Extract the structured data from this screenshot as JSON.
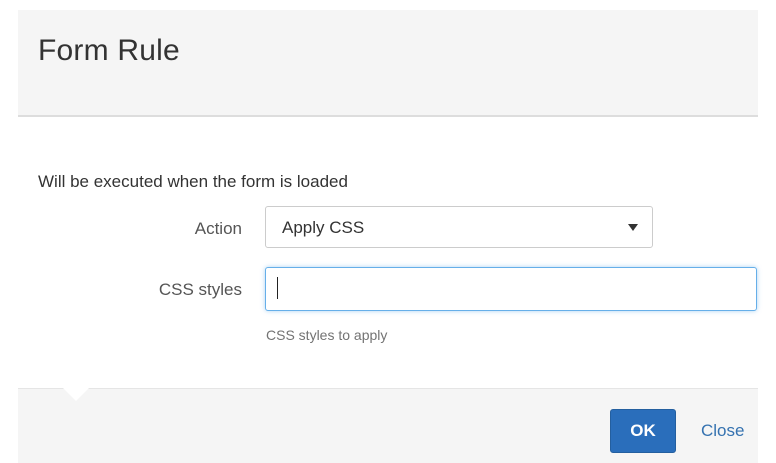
{
  "dialog": {
    "title": "Form Rule"
  },
  "body": {
    "description": "Will be executed when the form is loaded",
    "action": {
      "label": "Action",
      "selected_value": "Apply CSS"
    },
    "css_styles": {
      "label": "CSS styles",
      "value": "",
      "help_text": "CSS styles to apply"
    }
  },
  "footer": {
    "ok_label": "OK",
    "close_label": "Close"
  },
  "colors": {
    "primary_button": "#2a6ebb",
    "link": "#3572b0",
    "focus_border": "#66afe9"
  }
}
